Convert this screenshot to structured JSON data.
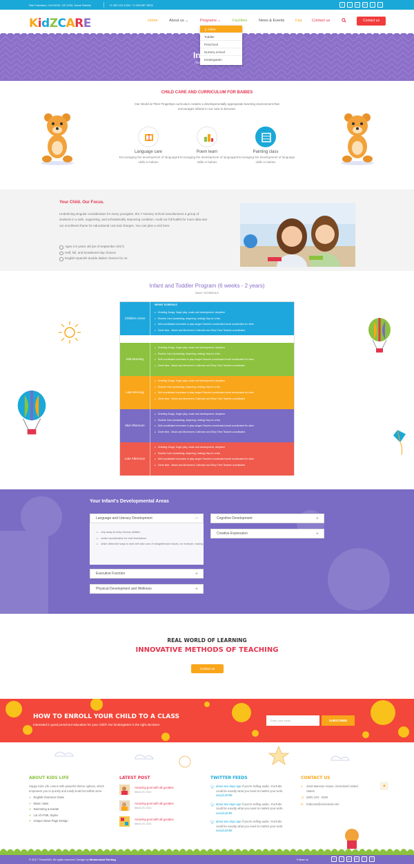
{
  "topbar": {
    "address": "San Francisco, CA 94102, US 1234, Some Streets",
    "phone": "+1 000 123 1234 / +1 000 567 5678",
    "social": [
      "Y",
      "f",
      "in",
      "G+",
      "t",
      "f"
    ]
  },
  "header": {
    "logo": "KIDZCARE",
    "nav": [
      "Home",
      "About us",
      "Programs",
      "Facilities",
      "News & Events",
      "Faq",
      "Contact us"
    ],
    "contact_button": "Contact us",
    "dropdown": [
      "Infant",
      "Toddler",
      "Preschool",
      "Nursery school",
      "Kindergarten"
    ]
  },
  "banner": {
    "title": "In",
    "crumb": "Abo"
  },
  "curriculum": {
    "title": "CHILD CARE AND CURRICULUM FOR BABIES",
    "desc": "Our World at Their Fingertips curriculum creates a developmentally appropriate learning environment that encourages infants in our care to become.",
    "features": [
      {
        "title": "Language care",
        "desc": "Encouraging the development of language skills in babies",
        "icon": "book-icon"
      },
      {
        "title": "Poem learn",
        "desc": "Encouraging the development of language skills in babies",
        "icon": "poem-icon"
      },
      {
        "title": "Painting class",
        "desc": "Encouraging the development of language skills in babies",
        "icon": "palette-icon"
      }
    ]
  },
  "focus": {
    "title": "Your Child. Our Focus.",
    "text": "Underlining singular consideration for every youngster, the Y Nursery School manufactures a group of students in a safe, supporting, and scholastically improving condition. Audit our full leaflet for more data and our enrollment frame for educational cost and charges. You can plan a visit here.",
    "list": [
      "Ages 2-5 years old (as of September 2017)",
      "Half, full, and broadened day choices",
      "English-Spanish double dialect choices for 4s"
    ]
  },
  "schedule": {
    "title": "Infant and Toddler Program (6 weeks - 2 years)",
    "subtitle": "DAILY SCHEDULE",
    "header": "INFANT SCHEDULE",
    "rows": [
      {
        "label": "Children Arrive",
        "color": "#1ea7dd"
      },
      {
        "label": "Mid-Morning",
        "color": "#8cc23f"
      },
      {
        "label": "Late Morning",
        "color": "#f9a61a"
      },
      {
        "label": "Mid-Afternoon",
        "color": "#7a6bc4"
      },
      {
        "label": "Late Afternoon",
        "color": "#ef5a4d"
      }
    ],
    "items": [
      "Greeting Songs, finger play, music and development, storytime",
      "Routine Care (sustaining, diapering, resting) Nap for a few",
      "Self-coordinated exercises in play ranges Teacher-coordinated small coordinated for other",
      "Circle time - Music and Movement, Calendar and Story Time Teacher-coordinated"
    ]
  },
  "dev_areas": {
    "title": "Your Infant's Developmental Areas",
    "left": [
      "Language and Literacy Development",
      "Executive Function",
      "Physical Development and Wellness"
    ],
    "right": [
      "Cognitive Development",
      "Creative Expression"
    ],
    "open_items": [
      "chip away at early memory abilities",
      "center consideration for brief timeframes",
      "utilize distinctive ways to deal with take care of straightforward issues, for example, making"
    ]
  },
  "learning": {
    "line1": "REAL WORLD OF LEARNING",
    "line2": "INNOVATIVE METHODS OF TEACHING",
    "button": "Contact us"
  },
  "enroll": {
    "title": "HOW TO ENROLL YOUR CHILD TO A CLASS",
    "subtitle": "Interested in good preschool education for your child? Our kindergarten is the right decision!",
    "placeholder": "Enter your email",
    "button": "SUBSCRIBE"
  },
  "footer": {
    "about_title": "ABOUT KIDS LIFE",
    "about_text": "Happy Kids Life comes with powerful theme options, which empowers you to quickly and easily build incredible store.",
    "about_list": [
      "English Grammar Class",
      "Music class",
      "Swimming & Karate",
      "Lot of HTML Styles",
      "Unique News Page Design"
    ],
    "posts_title": "LATEST POST",
    "posts": [
      {
        "title": "Amazing post with all goodies",
        "date": "March 23, 2014"
      },
      {
        "title": "Amazing post with all goodies",
        "date": "March 23, 2014"
      },
      {
        "title": "Amazing post with all goodies",
        "date": "March 23, 2014"
      }
    ],
    "twitter_title": "TWITTER FEEDS",
    "tweets": [
      {
        "link": "about two days ago",
        "text": "If you're selling audio, YouTube could be exactly what you need to market your work.",
        "url": "ow.ly/iu3V85"
      },
      {
        "link": "about two days ago",
        "text": "If you're selling audio, YouTube could be exactly what you need to market your work.",
        "url": "ow.ly/iu3V85"
      },
      {
        "link": "about two days ago",
        "text": "If you're selling audio, YouTube could be exactly what you need to market your work.",
        "url": "ow.ly/iu3V85"
      }
    ],
    "contact_title": "CONTACT US",
    "contact": [
      "4318 Mansion House, Greenland United States",
      "(500) 233 - 3236",
      "Kidscare@somemail.com"
    ],
    "copyright": "© 2017 ThemeMH. All rights reserved. Design by",
    "designer": "Mohammad Shohag",
    "follow": "Follow us"
  }
}
